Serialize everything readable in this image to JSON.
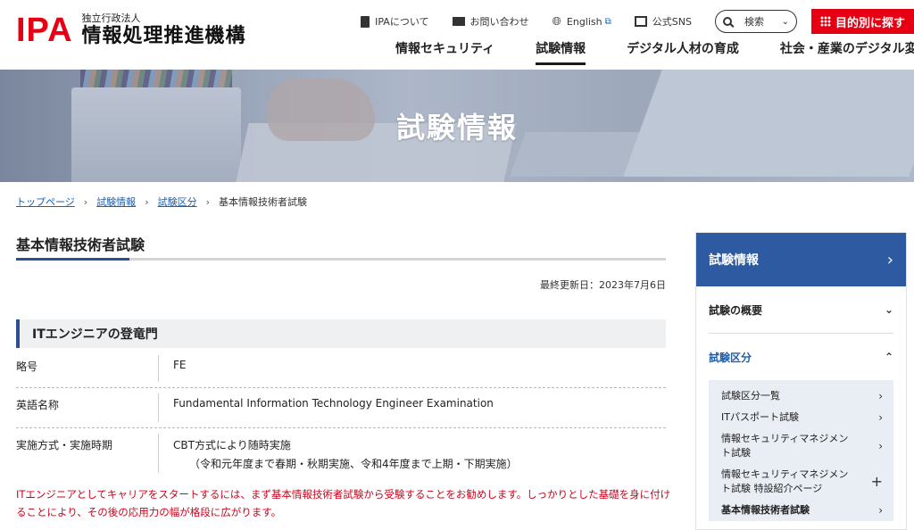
{
  "header": {
    "logo_ipa": "IPA",
    "logo_sub": "独立行政法人",
    "logo_main": "情報処理推進機構",
    "util": {
      "about": "IPAについて",
      "contact": "お問い合わせ",
      "english": "English",
      "sns": "公式SNS",
      "search": "検索",
      "purpose": "目的別に探す"
    },
    "gnav": [
      "情報セキュリティ",
      "試験情報",
      "デジタル人材の育成",
      "社会・産業のデジタル変革"
    ]
  },
  "hero": {
    "title": "試験情報"
  },
  "breadcrumb": {
    "home": "トップページ",
    "exam": "試験情報",
    "category": "試験区分",
    "current": "基本情報技術者試験"
  },
  "main": {
    "title": "基本情報技術者試験",
    "updated": "最終更新日：2023年7月6日",
    "section_title": "ITエンジニアの登竜門",
    "rows": [
      {
        "label": "略号",
        "value": "FE",
        "note": ""
      },
      {
        "label": "英語名称",
        "value": "Fundamental Information Technology Engineer Examination",
        "note": ""
      },
      {
        "label": "実施方式・実施時期",
        "value": "CBT方式により随時実施",
        "note": "（令和元年度まで春期・秋期実施、令和4年度まで上期・下期実施）"
      }
    ],
    "intro": "ITエンジニアとしてキャリアをスタートするには、まず基本情報技術者試験から受験することをお勧めします。しっかりとした基礎を身に付けることにより、その後の応用力の幅が格段に広がります。"
  },
  "sidebar": {
    "head": "試験情報",
    "items": [
      {
        "label": "試験の概要"
      },
      {
        "label": "試験区分"
      }
    ],
    "sub": [
      {
        "label": "試験区分一覧",
        "icon": "chevron-right"
      },
      {
        "label": "ITパスポート試験",
        "icon": "chevron-right"
      },
      {
        "label": "情報セキュリティマネジメント試験",
        "icon": "chevron-right"
      },
      {
        "label": "情報セキュリティマネジメント試験 特設紹介ページ",
        "icon": "plus"
      },
      {
        "label": "基本情報技術者試験",
        "icon": "chevron-right"
      }
    ]
  },
  "colors": {
    "brand_red": "#e60012",
    "navy": "#2d5aa0",
    "intro_red": "#d0021b"
  }
}
